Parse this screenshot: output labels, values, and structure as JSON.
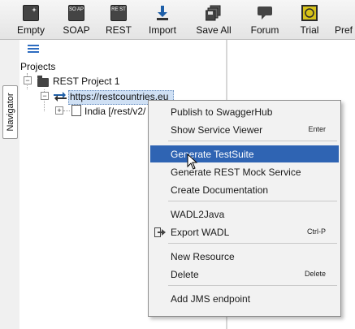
{
  "toolbar": {
    "buttons": [
      {
        "label": "Empty",
        "icon": "empty-project-icon"
      },
      {
        "label": "SOAP",
        "icon": "soap-icon"
      },
      {
        "label": "REST",
        "icon": "rest-icon"
      },
      {
        "label": "Import",
        "icon": "import-icon"
      },
      {
        "label": "Save All",
        "icon": "save-all-icon"
      },
      {
        "label": "Forum",
        "icon": "forum-icon"
      },
      {
        "label": "Trial",
        "icon": "trial-icon"
      },
      {
        "label": "Pref",
        "icon": "preferences-icon"
      }
    ],
    "soap_glyph": "SO AP",
    "rest_glyph": "RE ST"
  },
  "navigator": {
    "tab_label": "Navigator"
  },
  "tree": {
    "root_label": "Projects",
    "project_label": "REST Project 1",
    "service_label": "https://restcountries.eu",
    "resource_label": "India [/rest/v2/"
  },
  "context_menu": {
    "items": [
      {
        "label": "Publish to SwaggerHub",
        "shortcut": ""
      },
      {
        "label": "Show Service Viewer",
        "shortcut": "Enter"
      },
      {
        "label": "Generate TestSuite",
        "shortcut": "",
        "highlighted": true
      },
      {
        "label": "Generate REST Mock Service",
        "shortcut": ""
      },
      {
        "label": "Create Documentation",
        "shortcut": ""
      },
      {
        "label": "WADL2Java",
        "shortcut": ""
      },
      {
        "label": "Export WADL",
        "shortcut": "Ctrl-P",
        "icon": "export-icon"
      },
      {
        "label": "New Resource",
        "shortcut": ""
      },
      {
        "label": "Delete",
        "shortcut": "Delete"
      },
      {
        "label": "Add JMS endpoint",
        "shortcut": ""
      }
    ]
  },
  "colors": {
    "highlight": "#2f64b3",
    "selection": "#cfe0f4",
    "accent": "#2d6cc0"
  }
}
